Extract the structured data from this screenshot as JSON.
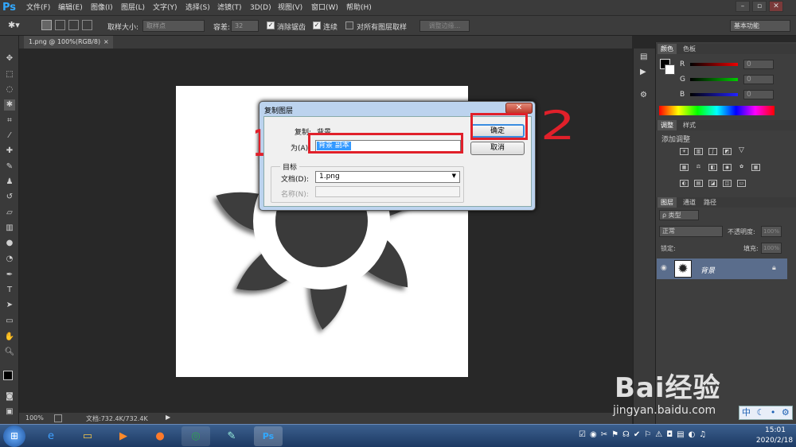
{
  "menubar": {
    "app_logo": "Ps",
    "items": [
      "文件(F)",
      "编辑(E)",
      "图像(I)",
      "图层(L)",
      "文字(Y)",
      "选择(S)",
      "滤镜(T)",
      "3D(D)",
      "视图(V)",
      "窗口(W)",
      "帮助(H)"
    ]
  },
  "options_bar": {
    "sample_size_label": "取样大小:",
    "sample_size_value": "取样点",
    "tolerance_label": "容差:",
    "tolerance_value": "32",
    "antialias_label": "消除锯齿",
    "contiguous_label": "连续",
    "all_layers_label": "对所有图层取样",
    "refine_edge_button": "调整边缘...",
    "workspace_value": "基本功能"
  },
  "document_tab": {
    "label": "1.png @ 100%(RGB/8)",
    "close": "×"
  },
  "status_bar": {
    "zoom": "100%",
    "doc_info": "文档:732.4K/732.4K"
  },
  "dialog": {
    "title": "复制图层",
    "copy_label": "复制:",
    "copy_value": "背景",
    "as_label": "为(A):",
    "as_value": "背景 副本",
    "target_group": "目标",
    "document_label": "文档(D):",
    "document_value": "1.png",
    "name_label": "名称(N):",
    "ok_button": "确定",
    "cancel_button": "取消"
  },
  "annotations": {
    "one": "1",
    "two": "2"
  },
  "panels": {
    "color_tabs": [
      "颜色",
      "色板"
    ],
    "rgb_labels": [
      "R",
      "G",
      "B"
    ],
    "rgb_values": [
      "0",
      "0",
      "0"
    ],
    "adjust_tabs": [
      "调整",
      "样式"
    ],
    "adjust_hint": "添加调整",
    "layers_tabs": [
      "图层",
      "通道",
      "路径"
    ],
    "kind_filter": "ρ 类型",
    "blend_mode": "正常",
    "opacity_label": "不透明度:",
    "opacity_value": "100%",
    "lock_label": "锁定:",
    "fill_label": "填充:",
    "fill_value": "100%",
    "layer_name": "背景"
  },
  "watermark": {
    "brand": "Bai经验",
    "url": "jingyan.baidu.com",
    "ime": "中"
  },
  "taskbar": {
    "time": "15:01",
    "date": "2020/2/18"
  },
  "colors": {
    "dialog_frame": "#bcd3ee",
    "annotation_red": "#e0202a",
    "ps_blue": "#31a8ff",
    "layer_selected": "#5a6d8c"
  }
}
